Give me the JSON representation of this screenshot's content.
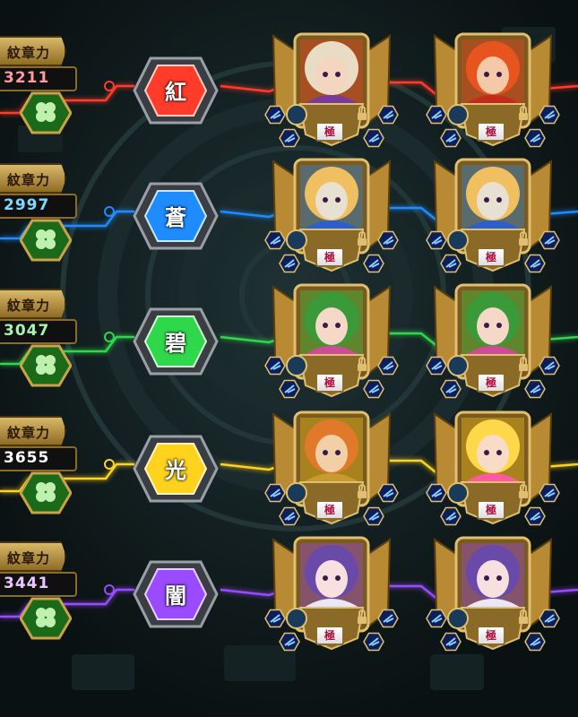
{
  "label": "紋章力",
  "colors": {
    "background": "#0d1516",
    "gold": "#c9a24a"
  },
  "rows": [
    {
      "id": "red",
      "element": "紅",
      "power": "3211",
      "color": "#ff3b2a",
      "power_color": "#ff9aa0",
      "cards": [
        {
          "name": "blonde-swordsman-portrait",
          "hair": "#e8dcc4",
          "skin": "#f3d5c0",
          "accent": "#7a3a9a",
          "level": "極"
        },
        {
          "name": "red-haired-hero-portrait",
          "hair": "#e8541e",
          "skin": "#f3c9a8",
          "accent": "#c22a1a",
          "level": "極"
        }
      ]
    },
    {
      "id": "blue",
      "element": "蒼",
      "power": "2997",
      "color": "#1e8cff",
      "power_color": "#7fd8ff",
      "cards": [
        {
          "name": "armored-wolf-knight-portrait",
          "hair": "#f0c060",
          "skin": "#e8e0d0",
          "accent": "#2a5fd0",
          "level": "極"
        },
        {
          "name": "armored-wolf-knight-portrait",
          "hair": "#f0c060",
          "skin": "#e8e0d0",
          "accent": "#2a5fd0",
          "level": "極"
        }
      ]
    },
    {
      "id": "green",
      "element": "碧",
      "power": "3047",
      "color": "#2fd84a",
      "power_color": "#a9f2b4",
      "cards": [
        {
          "name": "green-haired-woman-portrait",
          "hair": "#3a9a3a",
          "skin": "#f5d8c8",
          "accent": "#d04a9a",
          "level": "極"
        },
        {
          "name": "green-haired-woman-portrait",
          "hair": "#3a9a3a",
          "skin": "#f5d8c8",
          "accent": "#d04a9a",
          "level": "極"
        }
      ]
    },
    {
      "id": "light",
      "element": "光",
      "power": "3655",
      "color": "#ffd21e",
      "power_color": "#ffffff",
      "cards": [
        {
          "name": "orange-haired-warrior-portrait",
          "hair": "#e07a2a",
          "skin": "#f3cfa8",
          "accent": "#c89a30",
          "level": "極"
        },
        {
          "name": "blonde-idol-girl-portrait",
          "hair": "#ffd84a",
          "skin": "#f8dcc8",
          "accent": "#ff5aa0",
          "level": "極"
        }
      ]
    },
    {
      "id": "dark",
      "element": "闇",
      "power": "3441",
      "color": "#9a4aff",
      "power_color": "#e8c8ff",
      "cards": [
        {
          "name": "purple-haired-girl-portrait",
          "hair": "#6a4aa8",
          "skin": "#f8e0e0",
          "accent": "#e8e8f8",
          "level": "極"
        },
        {
          "name": "purple-haired-girl-portrait",
          "hair": "#6a4aa8",
          "skin": "#f8e0e0",
          "accent": "#e8e8f8",
          "level": "極"
        }
      ]
    }
  ]
}
